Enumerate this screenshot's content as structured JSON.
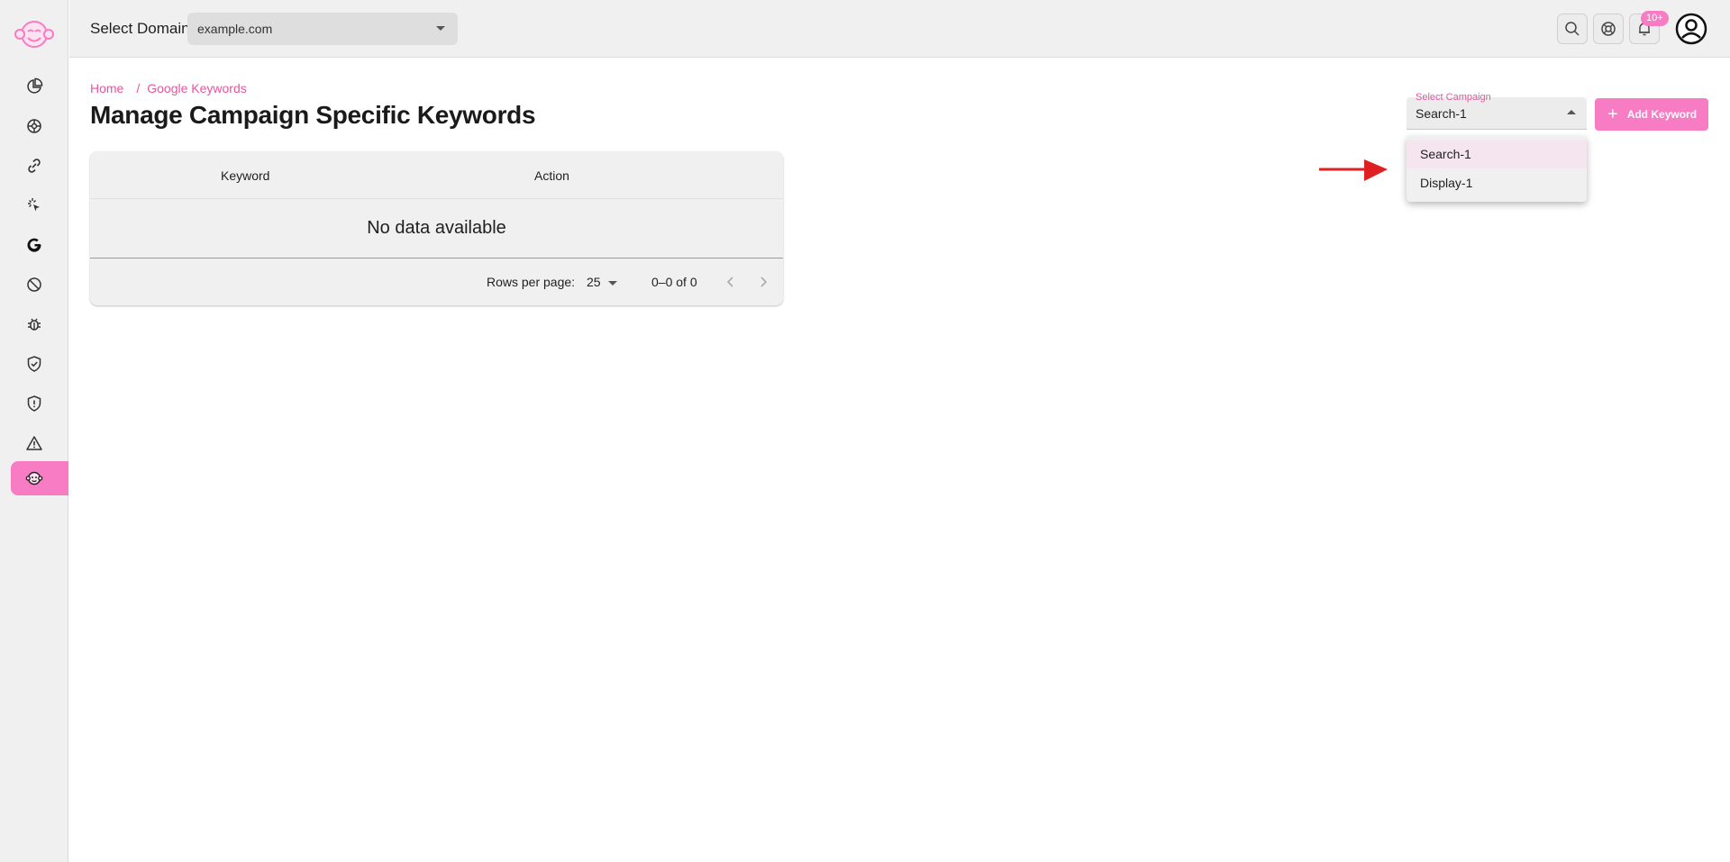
{
  "header": {
    "domain_label": "Select Domain",
    "domain_value": "example.com",
    "notification_badge": "10+"
  },
  "breadcrumb": {
    "home": "Home",
    "separator": "/",
    "current": "Google Keywords"
  },
  "page": {
    "title": "Manage Campaign Specific Keywords"
  },
  "table": {
    "columns": [
      "Keyword",
      "Action"
    ],
    "empty_text": "No data available",
    "rows_per_page_label": "Rows per page:",
    "rows_per_page_value": "25",
    "range_text": "0–0 of 0"
  },
  "campaign": {
    "label": "Select Campaign",
    "value": "Search-1",
    "options": [
      "Search-1",
      "Display-1"
    ]
  },
  "actions": {
    "add_keyword": "Add Keyword"
  },
  "colors": {
    "accent": "#f77cc4",
    "accent_text": "#e8559f",
    "arrow": "#e02020"
  },
  "icons": {
    "sidebar": [
      "pie-chart-icon",
      "settings-wheel-icon",
      "link-icon",
      "click-icon",
      "google-icon",
      "block-icon",
      "bug-icon",
      "shield-check-icon",
      "shield-alert-icon",
      "warning-icon",
      "monkey-icon"
    ]
  }
}
